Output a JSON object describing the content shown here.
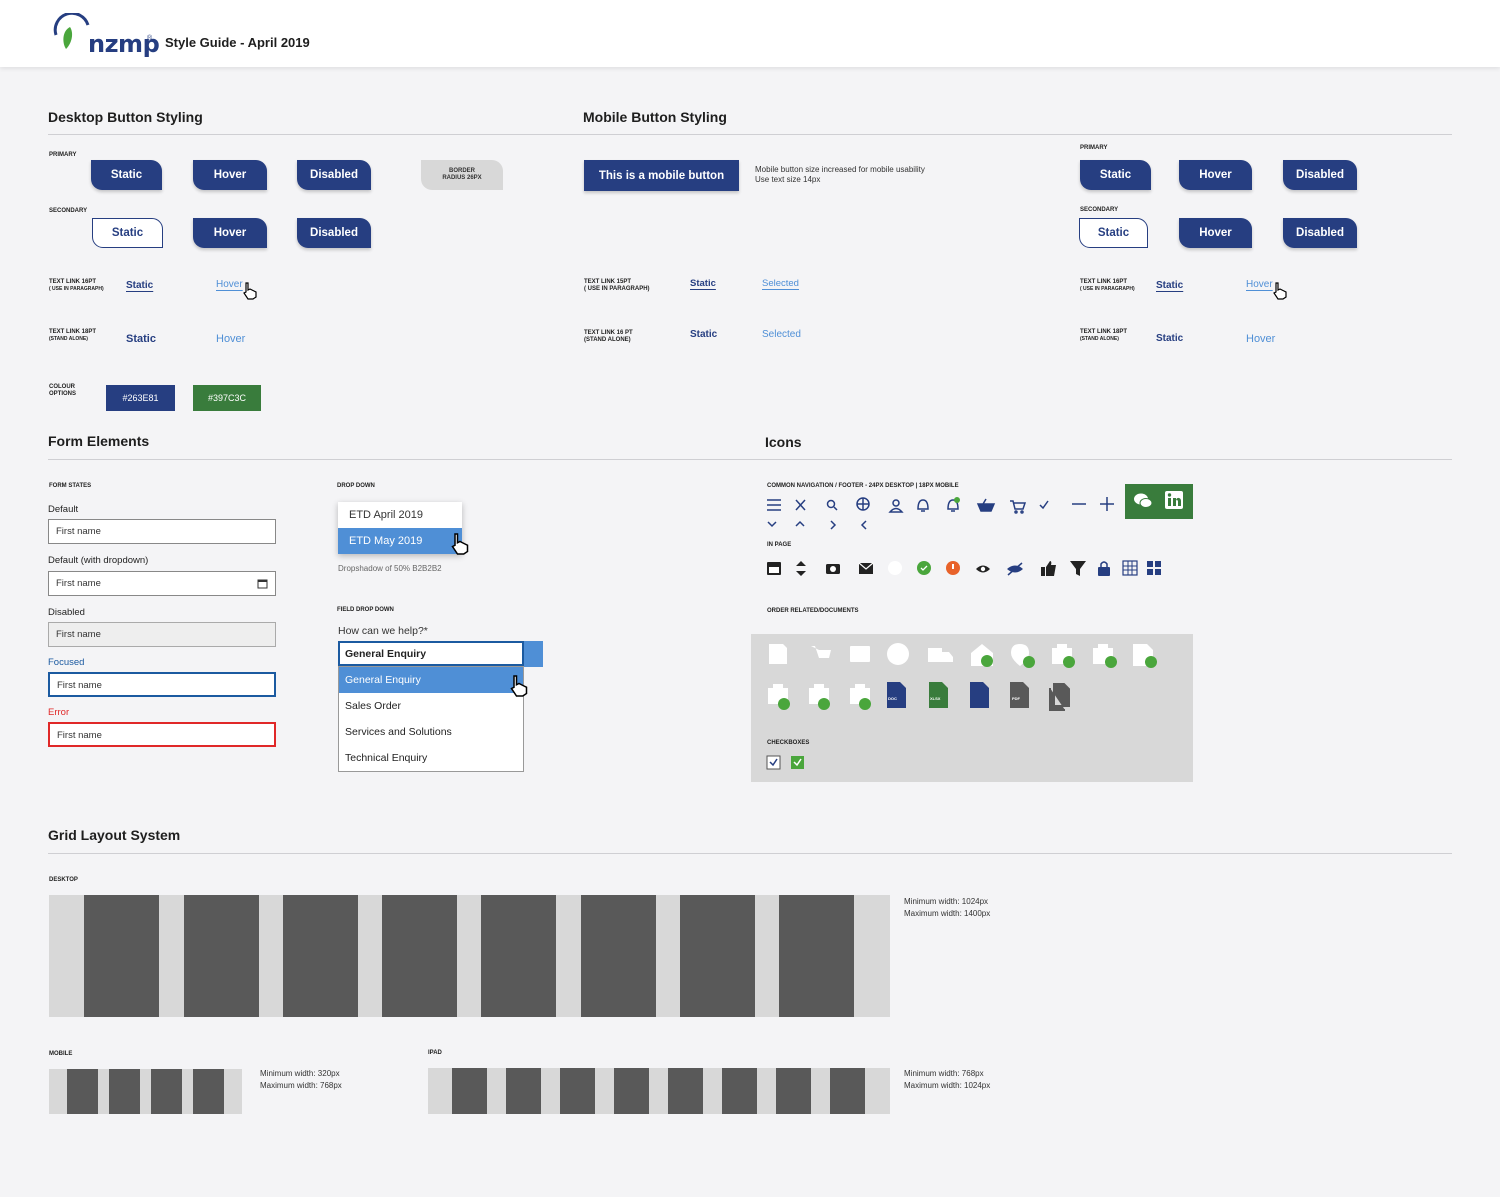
{
  "header": {
    "logo": "nzmp",
    "logo_tm": "®",
    "title": "Style Guide - April 2019"
  },
  "colors": {
    "primary": "#263E81",
    "green": "#397C3C",
    "hover_blue": "#4F8FD6",
    "error": "#E02828"
  },
  "desktop_buttons": {
    "heading": "Desktop Button Styling",
    "primary_label": "PRIMARY",
    "secondary_label": "SECONDARY",
    "static": "Static",
    "hover": "Hover",
    "disabled": "Disabled",
    "radius_note_1": "BORDER",
    "radius_note_2": "RADIUS 26PX",
    "text_link_16_1": "TEXT LINK 16PT",
    "text_link_16_2": "( USE IN PARAGRAPH)",
    "text_link_18_1": "TEXT LINK 18PT",
    "text_link_18_2": "(STAND ALONE)",
    "colour_1": "COLOUR",
    "colour_2": "OPTIONS",
    "swatch_blue": "#263E81",
    "swatch_green": "#397C3C"
  },
  "mobile_buttons": {
    "heading": "Mobile Button Styling",
    "mobile_button": "This is a mobile button",
    "note_1": "Mobile button size increased for mobile usability",
    "note_2": "Use text size 14px",
    "primary_label": "PRIMARY",
    "secondary_label": "SECONDARY",
    "static": "Static",
    "hover": "Hover",
    "disabled": "Disabled",
    "selected": "Selected",
    "text_link_15_1": "TEXT LINK 15PT",
    "text_link_15_2": "( USE IN PARAGRAPH)",
    "text_link_16s_1": "TEXT LINK 16 PT",
    "text_link_16s_2": "(STAND ALONE)",
    "text_link_16_1": "TEXT LINK 16PT",
    "text_link_16_2": "( USE IN PARAGRAPH)",
    "text_link_18_1": "TEXT LINK 18PT",
    "text_link_18_2": "(STAND ALONE)"
  },
  "form": {
    "heading": "Form Elements",
    "states_label": "FORM STATES",
    "default": "Default",
    "default_dropdown": "Default (with dropdown)",
    "disabled": "Disabled",
    "focused": "Focused",
    "error": "Error",
    "placeholder": "First name",
    "dropdown_label": "DROP DOWN",
    "dropdown_items": [
      "ETD April 2019",
      "ETD May 2019"
    ],
    "dropshadow_note": "Dropshadow of 50% B2B2B2",
    "field_dropdown_label": "FIELD DROP DOWN",
    "field_question": "How can we help?*",
    "field_value": "General Enquiry",
    "field_options": [
      "General Enquiry",
      "Sales Order",
      "Services and Solutions",
      "Technical Enquiry"
    ]
  },
  "icons": {
    "heading": "Icons",
    "nav_label": "COMMON NAVIGATION / FOOTER - 24PX DESKTOP | 18PX MOBILE",
    "in_page_label": "IN PAGE",
    "order_label": "ORDER RELATED/DOCUMENTS",
    "checkboxes_label": "CHECKBOXES",
    "doc_labels": [
      "DOC",
      "XLSX",
      "PDF"
    ]
  },
  "grid": {
    "heading": "Grid Layout System",
    "desktop_label": "DESKTOP",
    "desktop_min": "Minimum width: 1024px",
    "desktop_max": "Maximum width: 1400px",
    "mobile_label": "MOBILE",
    "mobile_min": "Minimum width: 320px",
    "mobile_max": "Maximum width: 768px",
    "ipad_label": "IPAD",
    "ipad_min": "Minimum width: 768px",
    "ipad_max": "Maximum width: 1024px"
  }
}
